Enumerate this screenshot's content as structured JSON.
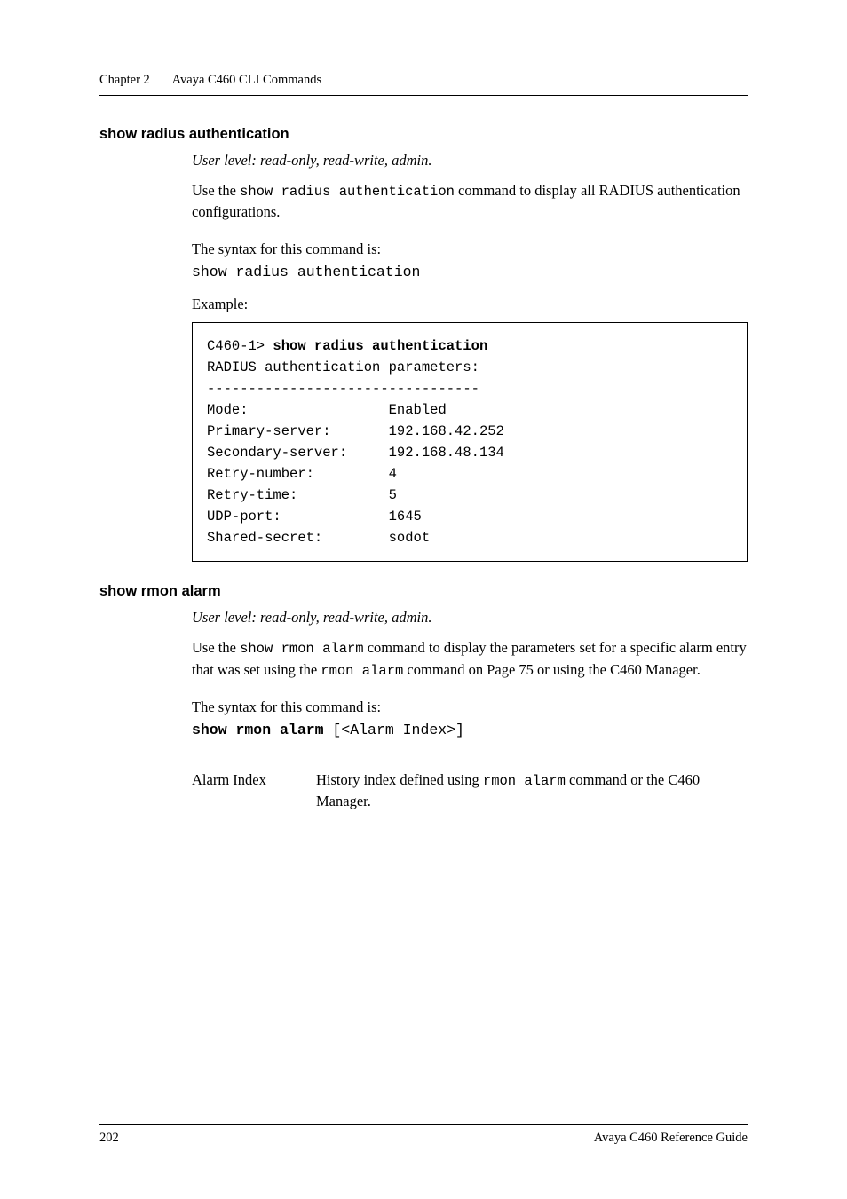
{
  "running_head": {
    "chapter": "Chapter 2",
    "title": "Avaya C460 CLI Commands"
  },
  "section1": {
    "title": "show radius authentication",
    "user_level": "User level: read-only, read-write, admin.",
    "desc_pre": "Use the ",
    "desc_cmd": "show radius authentication",
    "desc_post": " command to display all RADIUS authentication configurations.",
    "syntax_lead": "The syntax for this command is:",
    "syntax_cmd": "show radius authentication",
    "example_label": "Example:",
    "example": {
      "prompt": "C460-1> ",
      "typed": "show radius authentication",
      "lines": [
        "RADIUS authentication parameters:",
        "---------------------------------",
        "Mode:                 Enabled",
        "Primary-server:       192.168.42.252",
        "Secondary-server:     192.168.48.134",
        "Retry-number:         4",
        "Retry-time:           5",
        "UDP-port:             1645",
        "Shared-secret:        sodot"
      ]
    }
  },
  "section2": {
    "title": "show rmon alarm",
    "user_level": "User level: read-only, read-write, admin.",
    "desc_pre": "Use the ",
    "desc_cmd1": "show rmon alarm",
    "desc_mid": " command to display the parameters set for a specific alarm entry that was set using the ",
    "desc_cmd2": "rmon alarm",
    "desc_post": " command on Page 75 or using the C460 Manager.",
    "syntax_lead": "The syntax for this command is:",
    "syntax_cmd_bold": "show rmon alarm",
    "syntax_cmd_rest": " [<Alarm Index>]",
    "param": {
      "name": "Alarm Index",
      "desc_pre": "History index defined using ",
      "desc_cmd": "rmon alarm",
      "desc_post": " command or the C460 Manager."
    }
  },
  "footer": {
    "page": "202",
    "doc": "Avaya C460 Reference Guide"
  }
}
